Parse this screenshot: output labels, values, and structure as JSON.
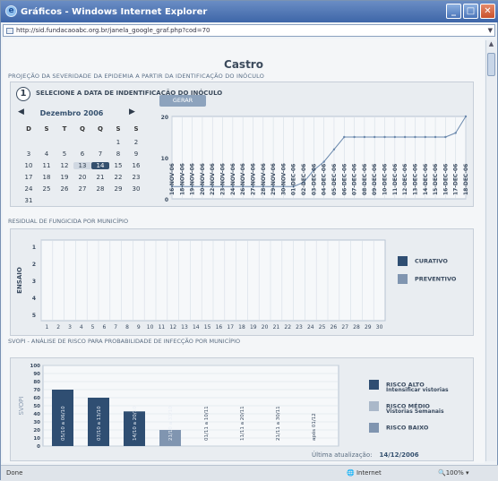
{
  "window": {
    "title": "Gráficos - Windows Internet Explorer",
    "url": "http://sid.fundacaoabc.org.br/janela_google_graf.php?cod=70"
  },
  "page": {
    "city": "Castro",
    "projection_title": "PROJEÇÃO DA SEVERIDADE DA EPIDEMIA A PARTIR DA IDENTIFICAÇÃO DO INÓCULO"
  },
  "step": {
    "number": "1",
    "label": "SELECIONE A DATA DE INDENTIFICAÇÃO DO INÓCULO"
  },
  "calendar": {
    "month": "Dezembro 2006",
    "weekdays": [
      "D",
      "S",
      "T",
      "Q",
      "Q",
      "S",
      "S"
    ],
    "weeks": [
      [
        "",
        "",
        "",
        "",
        "",
        "1",
        "2"
      ],
      [
        "3",
        "4",
        "5",
        "6",
        "7",
        "8",
        "9"
      ],
      [
        "10",
        "11",
        "12",
        "13",
        "14",
        "15",
        "16"
      ],
      [
        "17",
        "18",
        "19",
        "20",
        "21",
        "22",
        "23"
      ],
      [
        "24",
        "25",
        "26",
        "27",
        "28",
        "29",
        "30"
      ],
      [
        "31",
        "",
        "",
        "",
        "",
        "",
        ""
      ]
    ],
    "selected": "14",
    "highlight": "13"
  },
  "gerar_button": "GERAR",
  "severity_chart": {
    "yticks": [
      "20",
      "10",
      "0"
    ],
    "dates": [
      "16-NOV-06",
      "18-NOV-06",
      "19-NOV-06",
      "20-NOV-06",
      "22-NOV-06",
      "23-NOV-06",
      "24-NOV-06",
      "26-NOV-06",
      "27-NOV-06",
      "28-NOV-06",
      "29-NOV-06",
      "30-NOV-06",
      "01-DEC-06",
      "02-DEC-06",
      "03-DEC-06",
      "04-DEC-06",
      "05-DEC-06",
      "06-DEC-06",
      "07-DEC-06",
      "08-DEC-06",
      "09-DEC-06",
      "10-DEC-06",
      "11-DEC-06",
      "12-DEC-06",
      "13-DEC-06",
      "14-DEC-06",
      "15-DEC-06",
      "16-DEC-06",
      "17-DEC-06",
      "18-DEC-06"
    ]
  },
  "residual": {
    "title": "RESIDUAL DE FUNGICIDA POR MUNICÍPIO",
    "ylabel": "ENSAIO",
    "yticks": [
      "1",
      "2",
      "3",
      "4",
      "5"
    ],
    "xticks": [
      "1",
      "2",
      "3",
      "4",
      "5",
      "6",
      "7",
      "8",
      "9",
      "10",
      "11",
      "12",
      "13",
      "14",
      "15",
      "16",
      "17",
      "18",
      "19",
      "20",
      "21",
      "22",
      "23",
      "24",
      "25",
      "26",
      "27",
      "28",
      "29",
      "30"
    ],
    "legend": [
      {
        "label": "CURATIVO",
        "color": "#2f4e72"
      },
      {
        "label": "PREVENTIVO",
        "color": "#8095b0"
      }
    ]
  },
  "svopi": {
    "title": "SVOPI - ANÁLISE DE RISCO PARA PROBABILIDADE DE INFECÇÃO POR MUNICÍPIO",
    "ylabel": "SVOPI",
    "yticks": [
      "100",
      "90",
      "80",
      "70",
      "60",
      "50",
      "40",
      "30",
      "20",
      "10",
      "0"
    ],
    "legend": [
      {
        "label": "RISCO ALTO",
        "sub": "Intensificar vistorias",
        "color": "#2f4e72"
      },
      {
        "label": "RISCO MÉDIO",
        "sub": "Vistorias Semanais",
        "color": "#aab8c9"
      },
      {
        "label": "RISCO BAIXO",
        "sub": "",
        "color": "#8095b0"
      }
    ],
    "update_label": "Última atualização:",
    "update_date": "14/12/2006"
  },
  "chart_data": [
    {
      "type": "line",
      "title": "",
      "x": [
        "16-NOV-06",
        "18-NOV-06",
        "19-NOV-06",
        "20-NOV-06",
        "22-NOV-06",
        "23-NOV-06",
        "24-NOV-06",
        "26-NOV-06",
        "27-NOV-06",
        "28-NOV-06",
        "29-NOV-06",
        "30-NOV-06",
        "01-DEC-06",
        "02-DEC-06",
        "03-DEC-06",
        "04-DEC-06",
        "05-DEC-06",
        "06-DEC-06",
        "07-DEC-06",
        "08-DEC-06",
        "09-DEC-06",
        "10-DEC-06",
        "11-DEC-06",
        "12-DEC-06",
        "13-DEC-06",
        "14-DEC-06",
        "15-DEC-06",
        "16-DEC-06",
        "17-DEC-06",
        "18-DEC-06"
      ],
      "y": [
        3,
        3,
        3,
        3,
        3,
        3,
        3,
        3,
        3,
        3,
        3,
        3,
        3,
        4,
        7,
        9,
        12,
        15,
        15,
        15,
        15,
        15,
        15,
        15,
        15,
        15,
        15,
        15,
        16,
        20
      ],
      "ylim": [
        0,
        20
      ],
      "xlabel": "",
      "ylabel": ""
    },
    {
      "type": "bar",
      "title": "",
      "categories": [
        "1",
        "2",
        "3",
        "4",
        "5",
        "6",
        "7",
        "8",
        "9",
        "10",
        "11",
        "12",
        "13",
        "14",
        "15",
        "16",
        "17",
        "18",
        "19",
        "20",
        "21",
        "22",
        "23",
        "24",
        "25",
        "26",
        "27",
        "28",
        "29",
        "30"
      ],
      "series": [
        {
          "name": "CURATIVO",
          "values": []
        },
        {
          "name": "PREVENTIVO",
          "values": []
        }
      ],
      "ylim": [
        1,
        5
      ],
      "xlabel": "",
      "ylabel": "ENSAIO"
    },
    {
      "type": "bar",
      "title": "",
      "categories": [
        "05/10 a 06/10",
        "07/10 a 13/10",
        "14/10 a 20/10",
        "21/10 a 31/10",
        "01/11 a 10/11",
        "11/11 a 20/11",
        "21/11 a 30/11",
        "após 01/12"
      ],
      "values": [
        70,
        60,
        43,
        20,
        0,
        0,
        0,
        0
      ],
      "colors": [
        "#2f4e72",
        "#2f4e72",
        "#2f4e72",
        "#8095b0",
        "",
        "",
        "",
        ""
      ],
      "ylim": [
        0,
        100
      ],
      "xlabel": "",
      "ylabel": "SVOPI"
    }
  ]
}
